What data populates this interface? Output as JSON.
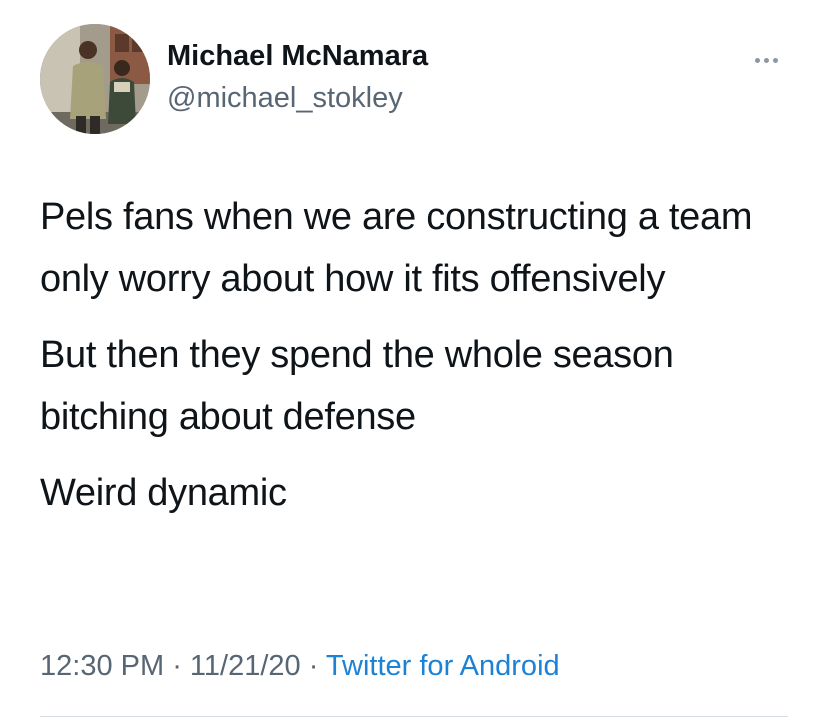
{
  "tweet": {
    "author": {
      "display_name": "Michael McNamara",
      "handle": "@michael_stokley",
      "avatar_icon": "profile-photo"
    },
    "more_icon": "more-horizontal-icon",
    "paragraphs": [
      "Pels fans when we are constructing a team only worry about how it fits offensively",
      "But then they spend the whole season bitching about defense",
      "Weird dynamic"
    ],
    "meta": {
      "time": "12:30 PM",
      "separator": "·",
      "date": "11/21/20",
      "source": "Twitter for Android"
    }
  },
  "colors": {
    "text": "#0f1419",
    "secondary": "#586674",
    "link": "#1d82d6",
    "divider": "#d7dde2"
  }
}
